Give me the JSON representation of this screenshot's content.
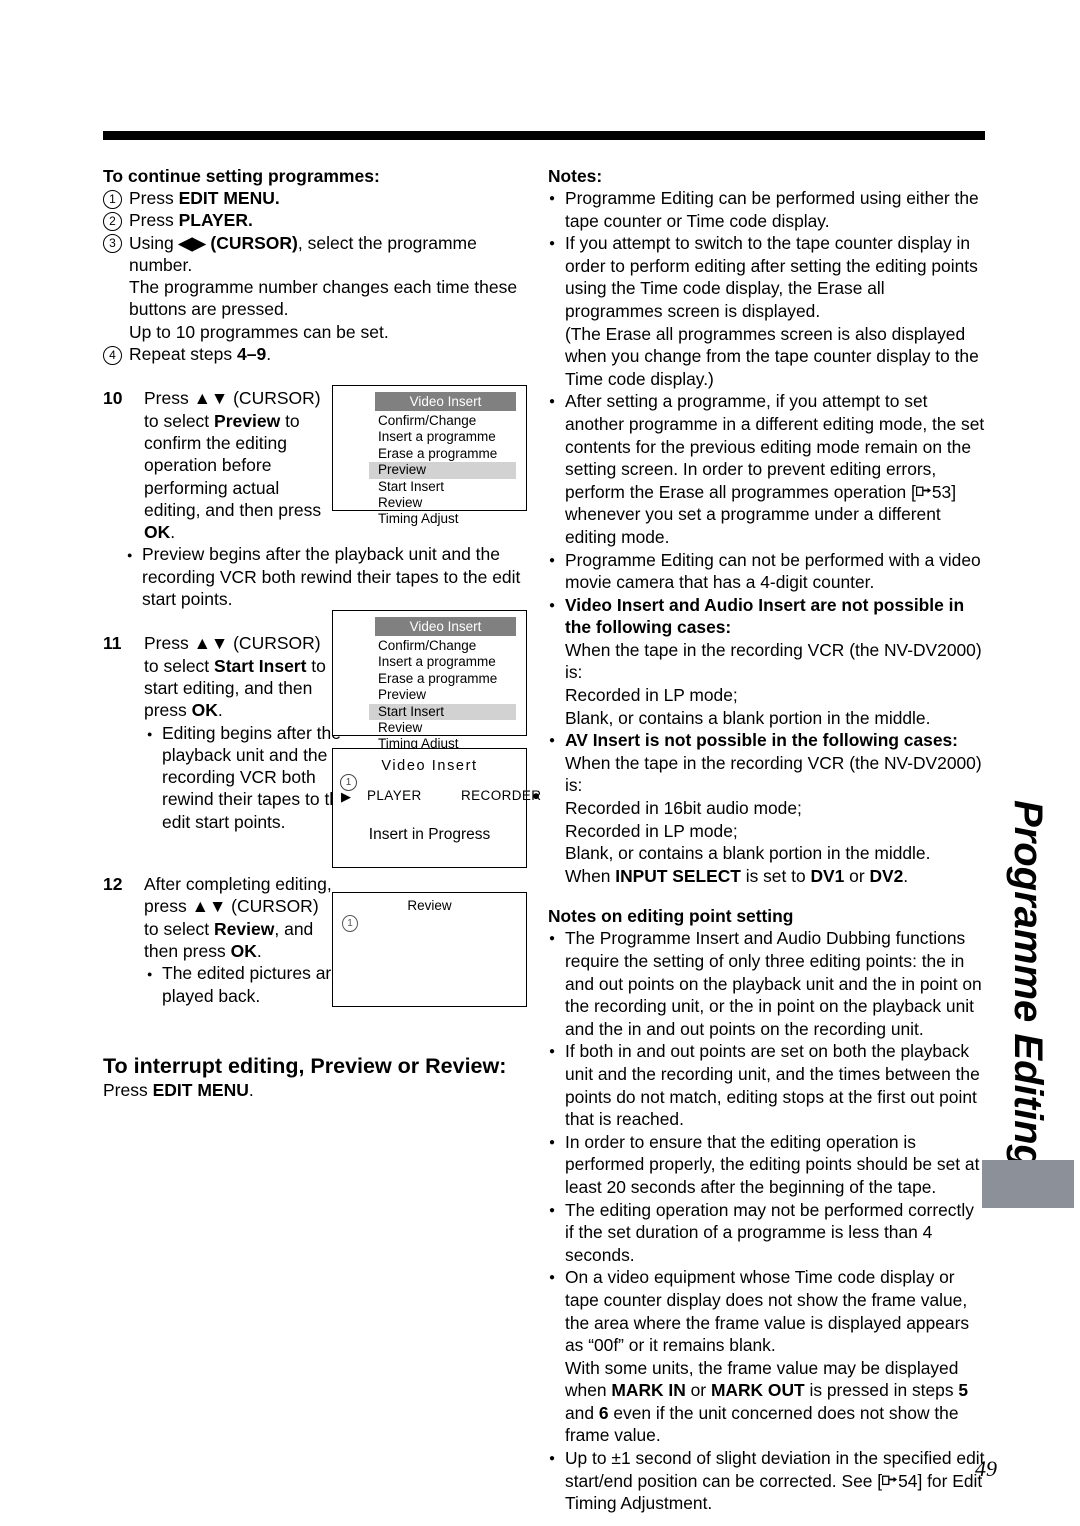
{
  "page": {
    "number": "49",
    "side_tab_label": "Programme Editing"
  },
  "left": {
    "continue_heading": "To continue setting programmes:",
    "continue_steps": [
      {
        "marker": "1",
        "text_plain": "Press ",
        "text_bold": "EDIT MENU."
      },
      {
        "marker": "2",
        "text_plain": "Press ",
        "text_bold": "PLAYER."
      },
      {
        "marker": "3",
        "text_plain": "Using ",
        "cursor": "◀▶ (CURSOR)",
        "tail": ", select the programme number."
      },
      {
        "marker": "4",
        "text_plain": "Repeat steps ",
        "text_bold": "4–9",
        "tail": "."
      }
    ],
    "continue_note_1": "The programme number changes each time these buttons are pressed.",
    "continue_note_2": "Up to 10 programmes can be set.",
    "step10": {
      "number": "10",
      "line1": "Press ▲▼ (CURSOR)",
      "line2a": "to select ",
      "line2b": "Preview",
      "line2c": " to",
      "line3": "confirm the editing",
      "line4": "operation before",
      "line5": "performing actual",
      "line6": "editing, and then press",
      "line7": "OK",
      "line7b": ".",
      "bullet": "Preview begins after the playback unit and the recording VCR both rewind their tapes to the edit start points."
    },
    "step11": {
      "number": "11",
      "line1": "Press ▲▼ (CURSOR)",
      "line2a": "to select ",
      "line2b": "Start Insert",
      "line2c": " to",
      "line3": "start editing, and then",
      "line4a": "press ",
      "line4b": "OK",
      "line4c": ".",
      "bullet": "Editing begins after the playback unit and the recording VCR both rewind their tapes to the edit start points."
    },
    "step12": {
      "number": "12",
      "line1": "After completing editing,",
      "line2": "press ▲▼ (CURSOR)",
      "line3a": "to select ",
      "line3b": "Review",
      "line3c": ", and",
      "line4a": "then press ",
      "line4b": "OK",
      "line4c": ".",
      "bullet": "The edited pictures are played back."
    },
    "interrupt_heading": "To interrupt editing, Preview or Review:",
    "interrupt_text_plain": "Press ",
    "interrupt_text_bold": "EDIT MENU",
    "interrupt_text_tail": "."
  },
  "osd": {
    "menu_title": "Video Insert",
    "menu_items": [
      "Confirm/Change",
      "Insert a programme",
      "Erase a programme",
      "Preview",
      "Start Insert",
      "Review",
      "Timing Adjust"
    ],
    "menu1_selected": "Preview",
    "menu2_selected": "Start Insert",
    "progress": {
      "title": "Video Insert",
      "marker": "1",
      "play_symbol": "▶",
      "player_label": "PLAYER",
      "recorder_label": "RECORDER",
      "record_symbol": "●",
      "message": "Insert in Progress"
    },
    "review": {
      "title": "Review",
      "marker": "1"
    }
  },
  "right": {
    "notes_heading": "Notes:",
    "notes": [
      {
        "type": "bullet",
        "text": "Programme Editing can be performed using either the tape counter or Time code display."
      },
      {
        "type": "bullet",
        "text": "If you attempt to switch to the tape counter display in order to perform editing after setting the editing points using the Time code display, the Erase all programmes screen is displayed."
      },
      {
        "type": "plain",
        "text": "(The Erase all programmes  screen is also displayed when you change from the tape counter display to the Time code display.)"
      },
      {
        "type": "bullet_ref",
        "text_a": "After setting a programme, if you attempt to set another programme in a different editing mode, the set contents for the previous editing mode remain on the setting screen.  In order to prevent editing errors, perform the Erase all programmes operation [",
        "ref": "53",
        "text_b": "] whenever you set a programme under a different editing mode."
      },
      {
        "type": "bullet",
        "text": "Programme Editing can not be performed with a video movie camera that has a 4-digit counter."
      },
      {
        "type": "bullet_bold",
        "text": "Video Insert and Audio Insert are not possible in the following cases:"
      },
      {
        "type": "plain",
        "text": "When the tape in the recording VCR (the NV-DV2000) is:"
      },
      {
        "type": "plain",
        "text": "Recorded in LP mode;"
      },
      {
        "type": "plain",
        "text": "Blank, or contains a blank portion in the middle."
      },
      {
        "type": "bullet_bold",
        "text": "AV Insert is not possible in the following cases:"
      },
      {
        "type": "plain",
        "text": "When the tape in the recording VCR (the NV-DV2000) is:"
      },
      {
        "type": "plain",
        "text": "Recorded in 16bit audio mode;"
      },
      {
        "type": "plain",
        "text": "Recorded in LP mode;"
      },
      {
        "type": "plain",
        "text": "Blank, or contains a blank portion in the middle."
      },
      {
        "type": "plain_mixed",
        "a": "When ",
        "b": "INPUT SELECT",
        "c": " is set to ",
        "d": "DV1",
        "e": " or ",
        "f": "DV2",
        "g": "."
      }
    ],
    "editpoint_heading": "Notes on editing point setting",
    "editpoint_notes": [
      {
        "type": "bullet",
        "text": "The Programme Insert and Audio Dubbing functions require the setting of only three editing points: the in and out points on the playback unit and the in point on the recording unit, or the in point on the playback unit and the in and out points on the recording unit."
      },
      {
        "type": "bullet",
        "text": "If both in and out points are set on both the playback unit and the recording unit, and the times between the points do not match, editing stops at the first out point that is reached."
      },
      {
        "type": "bullet",
        "text": "In order to ensure that the editing operation is performed properly, the editing points should be set at least 20 seconds after the beginning of the tape."
      },
      {
        "type": "bullet",
        "text": "The editing operation may not be performed correctly if the set duration of a programme is less than 4 seconds."
      },
      {
        "type": "bullet",
        "text": "On a video equipment whose Time code display or tape counter display does not show the frame value, the area where the frame value is displayed appears as “00f” or it remains blank."
      },
      {
        "type": "plain_mixed2",
        "a": "With some units, the frame value may be displayed when ",
        "b": "MARK IN",
        "c": " or ",
        "d": "MARK OUT",
        "e": " is pressed in steps ",
        "f": "5",
        "g": " and ",
        "h": "6",
        "i": " even if the unit concerned does not show the frame value."
      },
      {
        "type": "bullet_ref2",
        "text_a": "Up to ±1 second of slight deviation in the specified edit start/end position can be corrected. See [",
        "ref": "54",
        "text_b": "] for Edit Timing Adjustment."
      }
    ]
  },
  "colors": {
    "osd_title_bg": "#808080",
    "osd_selected_bg": "#d2d2d2",
    "side_tab": "#8b9099",
    "rule": "#000000"
  }
}
